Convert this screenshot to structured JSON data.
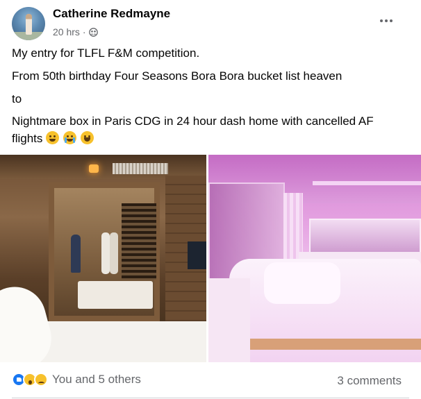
{
  "post": {
    "author": "Catherine Redmayne",
    "time": "20 hrs",
    "separator": "·",
    "privacy_icon": "friends-icon",
    "more_icon": "more-horizontal-icon",
    "lines": [
      "My entry for TLFL F&M competition.",
      "From 50th birthday Four Seasons Bora Bora bucket list heaven",
      "to",
      "Nightmare box in Paris CDG in 24 hour dash home  with cancelled AF",
      "flights"
    ],
    "emojis": [
      "tired-face-emoji",
      "crying-face-emoji",
      "grinning-sweat-emoji"
    ]
  },
  "photos": [
    {
      "name": "four-seasons-bora-bora-room-photo"
    },
    {
      "name": "paris-cdg-pod-room-photo"
    }
  ],
  "footer": {
    "reaction_icons": [
      "like-icon",
      "wow-icon",
      "sad-icon"
    ],
    "reactions_text": "You and 5 others",
    "comments_text": "3 comments"
  }
}
